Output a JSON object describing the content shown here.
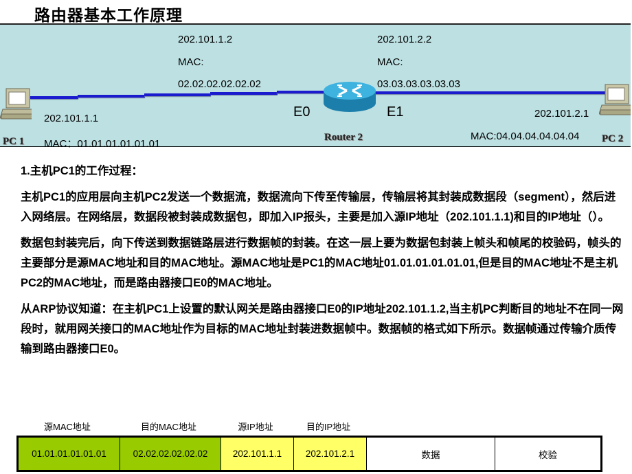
{
  "title": "路由器基本工作原理",
  "diagram": {
    "pc1": {
      "name": "PC 1",
      "ip": "202.101.1.1",
      "mac": "MAC：01.01.01.01.01.01",
      "icon": "computer-icon"
    },
    "pc2": {
      "name": "PC 2",
      "ip": "202.101.2.1",
      "mac": "MAC:04.04.04.04.04.04",
      "icon": "computer-icon"
    },
    "router": {
      "name": "Router 2",
      "icon": "router-icon"
    },
    "e0": {
      "port": "E0",
      "ip": "202.101.1.2",
      "mac_label": "MAC:",
      "mac": "02.02.02.02.02.02"
    },
    "e1": {
      "port": "E1",
      "ip": "202.101.2.2",
      "mac_label": "MAC:",
      "mac": "03.03.03.03.03.03"
    },
    "colors": {
      "background": "#bde0e2",
      "link": "#1a1acf"
    }
  },
  "body": {
    "heading": "1.主机PC1的工作过程：",
    "paragraphs": [
      "主机PC1的应用层向主机PC2发送一个数据流，数据流向下传至传输层，传输层将其封装成数据段（segment），然后进入网络层。在网络层，数据段被封装成数据包，即加入IP报头，主要是加入源IP地址（202.101.1.1)和目的IP地址（）。",
      "数据包封装完后，向下传送到数据链路层进行数据帧的封装。在这一层上要为数据包封装上帧头和帧尾的校验码，帧头的主要部分是源MAC地址和目的MAC地址。源MAC地址是PC1的MAC地址01.01.01.01.01.01,但是目的MAC地址不是主机PC2的MAC地址，而是路由器接口E0的MAC地址。",
      "从ARP协议知道：在主机PC1上设置的默认网关是路由器接口E0的IP地址202.101.1.2,当主机PC判断目的地址不在同一网段时，就用网关接口的MAC地址作为目标的MAC地址封装进数据帧中。数据帧的格式如下所示。数据帧通过传输介质传输到路由器接口E0。"
    ]
  },
  "frame": {
    "headers": [
      "源MAC地址",
      "目的MAC地址",
      "源IP地址",
      "目的IP地址"
    ],
    "cells": [
      {
        "value": "01.01.01.01.01.01",
        "color": "#99cc00"
      },
      {
        "value": "02.02.02.02.02.02",
        "color": "#99cc00"
      },
      {
        "value": "202.101.1.1",
        "color": "#ffff66"
      },
      {
        "value": "202.101.2.1",
        "color": "#ffff66"
      },
      {
        "value": "数据",
        "color": "#ffffff"
      },
      {
        "value": "校验",
        "color": "#ffffff"
      }
    ]
  }
}
